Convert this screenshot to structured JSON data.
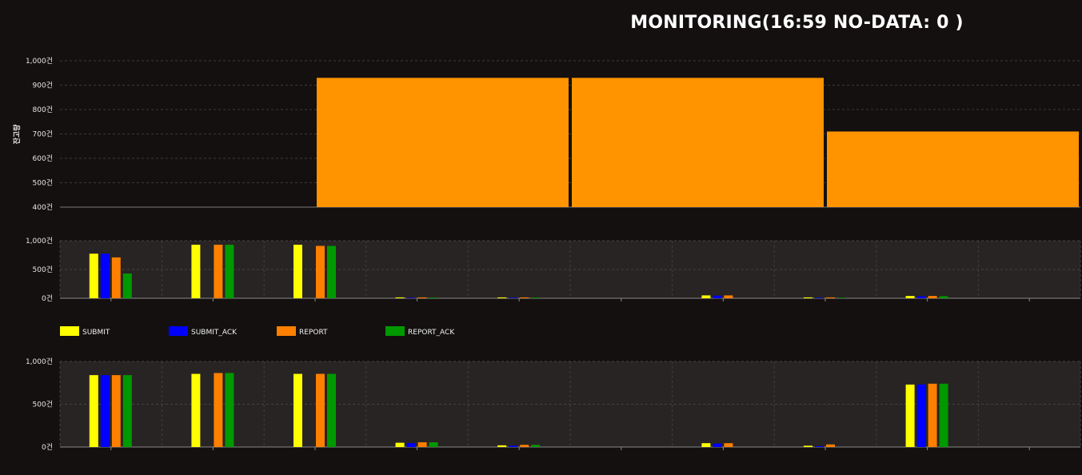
{
  "header": {
    "title": "MONITORING(16:59 NO-DATA: 0 )"
  },
  "colors": {
    "background": "#141010",
    "plot_background": "#282423",
    "balance_bar": "#ff9300",
    "submit": "#ffff00",
    "submit_ack": "#0000ff",
    "report": "#ff7f00",
    "report_ack": "#009900"
  },
  "legend": {
    "items": [
      {
        "label": "SUBMIT",
        "color": "#ffff00"
      },
      {
        "label": "SUBMIT_ACK",
        "color": "#0000ff"
      },
      {
        "label": "REPORT",
        "color": "#ff7f00"
      },
      {
        "label": "REPORT_ACK",
        "color": "#009900"
      }
    ]
  },
  "chart_data": [
    {
      "type": "bar",
      "ylabel": "잔고량",
      "ylim": [
        400,
        1000
      ],
      "yticks": [
        "1,000건",
        "900건",
        "800건",
        "700건",
        "600건",
        "500건",
        "400건"
      ],
      "ytick_values": [
        1000,
        900,
        800,
        700,
        600,
        500,
        400
      ],
      "grid": true,
      "values": [
        400,
        930,
        930,
        710
      ]
    },
    {
      "type": "bar",
      "ylim": [
        0,
        1000
      ],
      "yticks": [
        "1,000건",
        "500건",
        "0건"
      ],
      "ytick_values": [
        1000,
        500,
        0
      ],
      "grid": true,
      "series": [
        {
          "name": "SUBMIT",
          "values": [
            775,
            930,
            930,
            15,
            15,
            0,
            50,
            15,
            40,
            0
          ]
        },
        {
          "name": "SUBMIT_ACK",
          "values": [
            775,
            0,
            0,
            10,
            10,
            0,
            45,
            10,
            35,
            0
          ]
        },
        {
          "name": "REPORT",
          "values": [
            710,
            930,
            910,
            15,
            15,
            0,
            50,
            15,
            40,
            0
          ]
        },
        {
          "name": "REPORT_ACK",
          "values": [
            430,
            930,
            910,
            12,
            12,
            0,
            0,
            10,
            35,
            0
          ]
        }
      ]
    },
    {
      "type": "bar",
      "ylim": [
        0,
        1000
      ],
      "yticks": [
        "1,000건",
        "500건",
        "0건"
      ],
      "ytick_values": [
        1000,
        500,
        0
      ],
      "grid": true,
      "series": [
        {
          "name": "SUBMIT",
          "values": [
            840,
            855,
            855,
            50,
            20,
            0,
            45,
            15,
            730,
            0
          ]
        },
        {
          "name": "SUBMIT_ACK",
          "values": [
            840,
            0,
            0,
            45,
            15,
            0,
            40,
            10,
            730,
            0
          ]
        },
        {
          "name": "REPORT",
          "values": [
            840,
            865,
            855,
            55,
            25,
            0,
            45,
            30,
            740,
            0
          ]
        },
        {
          "name": "REPORT_ACK",
          "values": [
            840,
            865,
            855,
            55,
            25,
            0,
            0,
            0,
            740,
            0
          ]
        }
      ]
    }
  ]
}
